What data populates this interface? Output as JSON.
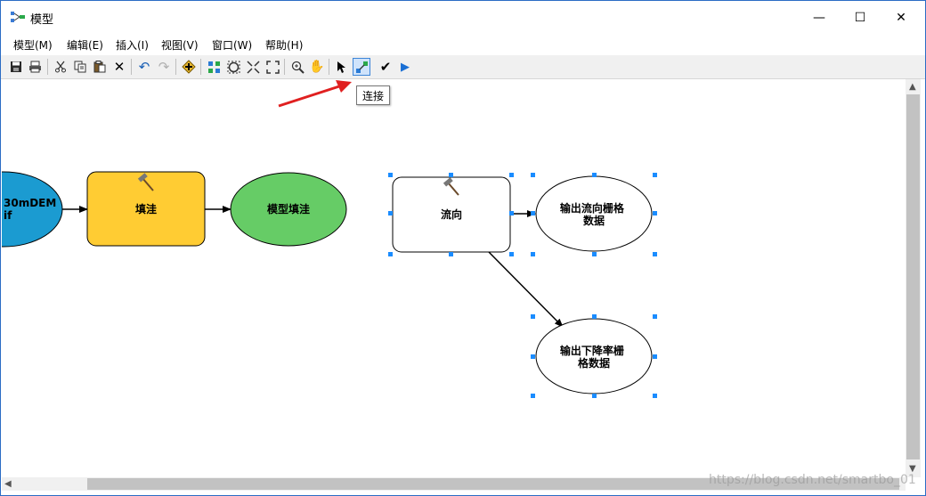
{
  "window": {
    "title": "模型",
    "minimize_glyph": "—",
    "maximize_glyph": "☐",
    "close_glyph": "✕"
  },
  "menu": [
    "模型(M)",
    "编辑(E)",
    "插入(I)",
    "视图(V)",
    "窗口(W)",
    "帮助(H)"
  ],
  "toolbar": {
    "icons": [
      "save-icon",
      "print-icon",
      "cut-icon",
      "copy-icon",
      "paste-icon",
      "delete-icon",
      "undo-icon",
      "redo-icon",
      "add-data-icon",
      "auto-layout-icon",
      "full-extent-icon",
      "fixed-zoom-in-icon",
      "fixed-zoom-out-icon",
      "zoom-in-icon",
      "pan-icon",
      "select-icon",
      "connect-icon",
      "validate-icon",
      "run-icon"
    ],
    "active": "connect-icon"
  },
  "tooltip": "连接",
  "diagram": {
    "input_node": "30mDEM\nif",
    "tool_fill": "填洼",
    "output_fill": "模型填洼",
    "tool_flowdir": "流向",
    "output_flowdir": "输出流向栅格\n数据",
    "output_drop": "输出下降率栅\n格数据"
  },
  "colors": {
    "input_blue": "#1b9bd1",
    "tool_yellow": "#ffcc33",
    "output_green": "#66cc66",
    "selection": "#1a8cff",
    "annotation_red": "#e02020"
  },
  "watermark": "https://blog.csdn.net/smartbo_01"
}
